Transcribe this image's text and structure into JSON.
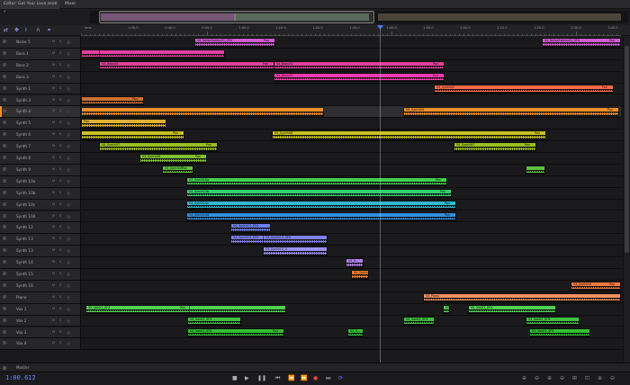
{
  "tabs": [
    {
      "label": "Editor: Got Your Love.sesx *"
    },
    {
      "label": "Mixer"
    }
  ],
  "timeline": {
    "ruler_start_label": "hms",
    "ruler_labels": [
      "0:30.0",
      "0:40.0",
      "0:50.0",
      "1:00.0",
      "1:10.0",
      "1:20.0",
      "1:30.0",
      "1:40.0",
      "1:50.0",
      "2:00.0",
      "2:10.0",
      "2:20.0",
      "2:30.0",
      "2:40.0"
    ]
  },
  "track_buttons": {
    "mute": "M",
    "solo": "S"
  },
  "tracks": [
    {
      "name": "Noise 5",
      "clips": [
        {
          "label": "44_NoiseSweep01_SFX",
          "pan": "Pan",
          "color": "#d05ad0"
        },
        {
          "label": "44_NoiseSweep01_SFX",
          "pan": "Pan",
          "color": "#d05ad0"
        }
      ]
    },
    {
      "name": "Bass 1",
      "clips": [
        {
          "label": "",
          "pan": "",
          "color": "#e040a0"
        },
        {
          "label": "",
          "pan": "",
          "color": "#e040a0"
        }
      ]
    },
    {
      "name": "Bass 2",
      "clips": [
        {
          "label": "54_Bass03",
          "pan": "Pan",
          "color": "#e0409a"
        },
        {
          "label": "54_Bass03",
          "pan": "Pan",
          "color": "#e0409a"
        }
      ]
    },
    {
      "name": "Bass 3",
      "clips": [
        {
          "label": "53_Bass03",
          "pan": "Pan",
          "color": "#ff3ab0"
        }
      ]
    },
    {
      "name": "Synth 1",
      "clips": [
        {
          "label": "54_Synth02",
          "pan": "Pan",
          "color": "#ff6a4a"
        }
      ]
    },
    {
      "name": "Synth 3",
      "clips": [
        {
          "label": "",
          "pan": "Pan",
          "color": "#d07030"
        }
      ]
    },
    {
      "name": "Synth 4",
      "selected": true,
      "clips": [
        {
          "label": "",
          "pan": "",
          "color": "#f0902a"
        },
        {
          "label": "53_Synth04",
          "pan": "Pan",
          "color": "#f0902a"
        }
      ]
    },
    {
      "name": "Synth 5",
      "clips": [
        {
          "label": "Pan",
          "pan": "",
          "color": "#e0b030"
        }
      ]
    },
    {
      "name": "Synth 6",
      "clips": [
        {
          "label": "",
          "pan": "Pan",
          "color": "#c8c020"
        },
        {
          "label": "53_Synth06",
          "pan": "Pan",
          "color": "#c8c020"
        }
      ]
    },
    {
      "name": "Synth 7",
      "clips": [
        {
          "label": "54_Synth07",
          "pan": "Pan",
          "color": "#9ac020"
        },
        {
          "label": "54_Synth07",
          "pan": "Pan",
          "color": "#9ac020"
        }
      ]
    },
    {
      "name": "Synth 8",
      "clips": [
        {
          "label": "53_Synth08",
          "pan": "Pan",
          "color": "#80c030"
        }
      ]
    },
    {
      "name": "Synth 9",
      "clips": [
        {
          "label": "53_Synth09",
          "pan": "Pan",
          "color": "#60c040"
        },
        {
          "label": "",
          "pan": "",
          "color": "#60c040"
        }
      ]
    },
    {
      "name": "Synth 10a",
      "clips": [
        {
          "label": "53_Synth10a",
          "pan": "Pan",
          "color": "#40d050"
        }
      ]
    },
    {
      "name": "Synth 10b",
      "clips": [
        {
          "label": "53_Synth10b",
          "pan": "Pan",
          "color": "#30d070"
        }
      ]
    },
    {
      "name": "Synth 10c",
      "clips": [
        {
          "label": "53_Synth10c",
          "pan": "Pan",
          "color": "#30b8d0"
        }
      ]
    },
    {
      "name": "Synth 10d",
      "clips": [
        {
          "label": "53_Synth10d",
          "pan": "Pan",
          "color": "#3090e0"
        }
      ]
    },
    {
      "name": "Synth 12",
      "clips": [
        {
          "label": "54_Synth12_SFX",
          "pan": "",
          "color": "#7080f0"
        }
      ]
    },
    {
      "name": "Synth 13",
      "clips": [
        {
          "label": "54_Synth13_SFX",
          "pan": "",
          "color": "#8080f0"
        },
        {
          "label": "54_Synth13_SFX",
          "pan": "",
          "color": "#8080f0"
        }
      ]
    },
    {
      "name": "Synth 13",
      "clips": [
        {
          "label": "53_Synth13_3",
          "pan": "",
          "color": "#9a90f0"
        }
      ]
    },
    {
      "name": "Synth 14",
      "clips": [
        {
          "label": "53_S...",
          "pan": "",
          "color": "#b080f0"
        }
      ]
    },
    {
      "name": "Synth 15",
      "clips": [
        {
          "label": "54_Synth15",
          "pan": "",
          "color": "#f08030"
        }
      ]
    },
    {
      "name": "Synth 16",
      "clips": [
        {
          "label": "53_Synth16",
          "pan": "Pan",
          "color": "#f07a40"
        }
      ]
    },
    {
      "name": "Piano",
      "clips": [
        {
          "label": "53_Piano",
          "pan": "",
          "color": "#f09060"
        }
      ]
    },
    {
      "name": "Vox 1",
      "clips": [
        {
          "label": "55_Vox01_SFX",
          "pan": "Pan",
          "color": "#50d050"
        },
        {
          "label": "",
          "pan": "",
          "color": "#50d050"
        },
        {
          "label": "55_Vox01_SFX",
          "pan": "",
          "color": "#50d050"
        },
        {
          "label": "55_Vox01_SFX",
          "pan": "",
          "color": "#50d050"
        }
      ]
    },
    {
      "name": "Vox 2",
      "clips": [
        {
          "label": "53_Vox02_SFX",
          "pan": "",
          "color": "#40c040"
        },
        {
          "label": "53_Vox02_SFX",
          "pan": "",
          "color": "#40c040"
        },
        {
          "label": "53_Vox02_SFX",
          "pan": "",
          "color": "#40c040"
        }
      ]
    },
    {
      "name": "Vox 3",
      "clips": [
        {
          "label": "53_Vox03_SFX",
          "pan": "Pan",
          "color": "#30c030"
        },
        {
          "label": "53_V...",
          "pan": "",
          "color": "#30c030"
        },
        {
          "label": "53_Vox03_SFX",
          "pan": "",
          "color": "#30c030"
        }
      ]
    },
    {
      "name": "Vox 4",
      "clips": []
    }
  ],
  "master": {
    "name": "Master"
  },
  "transport": {
    "timecode": "1:00.612"
  },
  "icons": {
    "stop": "stop-icon",
    "play": "play-icon",
    "pause": "pause-icon",
    "to_start": "skip-back-icon",
    "rewind": "rewind-icon",
    "forward": "fast-forward-icon",
    "to_end": "skip-forward-icon",
    "record": "record-icon",
    "loop": "loop-icon"
  }
}
